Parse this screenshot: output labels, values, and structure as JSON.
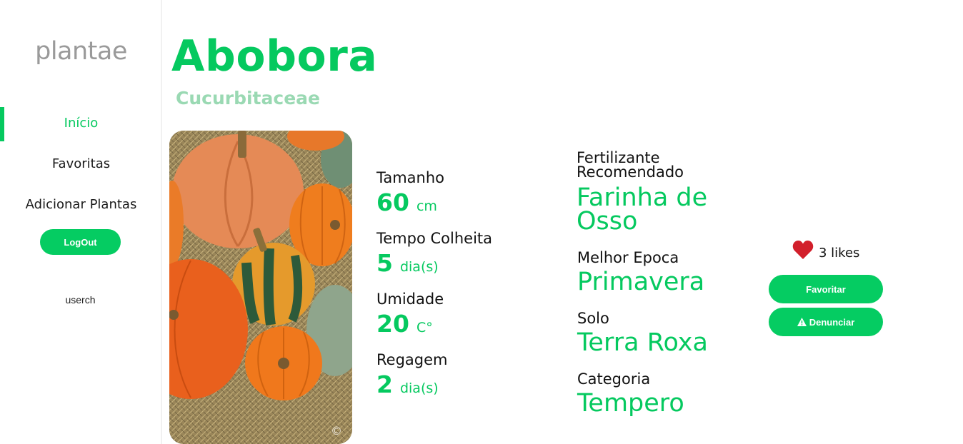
{
  "sidebar": {
    "logo": "plantae",
    "nav": [
      {
        "label": "Início",
        "active": true
      },
      {
        "label": "Favoritas"
      },
      {
        "label": "Adicionar Plantas"
      }
    ],
    "logout_label": "LogOut",
    "username": "userch"
  },
  "plant": {
    "name": "Abobora",
    "family": "Cucurbitaceae",
    "image_caption": "©",
    "stats": [
      {
        "label": "Tamanho",
        "value": "60",
        "unit": "cm"
      },
      {
        "label": "Tempo Colheita",
        "value": "5",
        "unit": "dia(s)"
      },
      {
        "label": "Umidade",
        "value": "20",
        "unit": "C°"
      },
      {
        "label": "Regagem",
        "value": "2",
        "unit": "dia(s)"
      }
    ],
    "details": [
      {
        "label": "Fertilizante Recomendado",
        "value": "Farinha de Osso"
      },
      {
        "label": "Melhor Epoca",
        "value": "Primavera"
      },
      {
        "label": "Solo",
        "value": "Terra Roxa"
      },
      {
        "label": "Categoria",
        "value": "Tempero"
      }
    ]
  },
  "actions": {
    "likes_text": "3 likes",
    "favorite_label": "Favoritar",
    "report_label": "Denunciar"
  },
  "colors": {
    "accent": "#05c95f",
    "subtitle": "#9ad9b3",
    "heart": "#d21f2b"
  },
  "icons": {
    "like": "heart-icon",
    "report": "warning-icon"
  }
}
